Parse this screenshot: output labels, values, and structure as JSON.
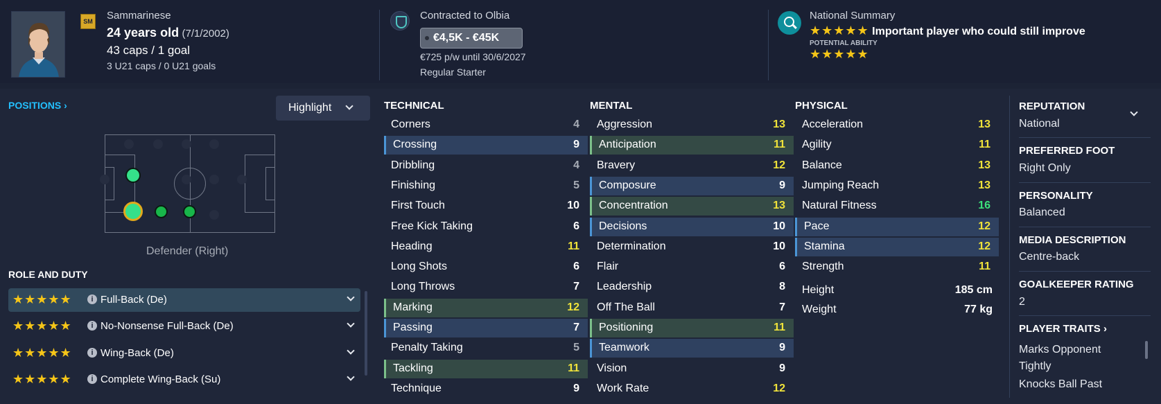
{
  "header": {
    "nationality": "Sammarinese",
    "age": "24 years old",
    "dob": "(7/1/2002)",
    "caps": "43 caps / 1 goal",
    "u21": "3 U21 caps / 0 U21 goals",
    "contract_title": "Contracted to Olbia",
    "value": "€4,5K - €45K",
    "wage": "€725 p/w until 30/6/2027",
    "squad_status": "Regular Starter",
    "summary_title": "National Summary",
    "summary_text": "Important player who could still improve",
    "potential_label": "POTENTIAL ABILITY",
    "current_stars": "★★★★★",
    "potential_stars": "★★★★★",
    "flag_icon": "flag-icon",
    "club_icon": "club-badge-icon",
    "search_icon": "search-icon"
  },
  "positions": {
    "heading": "POSITIONS ›",
    "highlight_label": "Highlight",
    "position_name": "Defender (Right)"
  },
  "roles": {
    "heading": "ROLE AND DUTY",
    "items": [
      {
        "stars": "★★★★★",
        "name": "Full-Back (De)"
      },
      {
        "stars": "★★★★★",
        "name": "No-Nonsense Full-Back (De)"
      },
      {
        "stars": "★★★★★",
        "name": "Wing-Back (De)"
      },
      {
        "stars": "★★★★★",
        "name": "Complete Wing-Back (Su)"
      }
    ]
  },
  "technical": {
    "heading": "TECHNICAL",
    "rows": [
      {
        "name": "Corners",
        "value": "4"
      },
      {
        "name": "Crossing",
        "value": "9"
      },
      {
        "name": "Dribbling",
        "value": "4"
      },
      {
        "name": "Finishing",
        "value": "5"
      },
      {
        "name": "First Touch",
        "value": "10"
      },
      {
        "name": "Free Kick Taking",
        "value": "6"
      },
      {
        "name": "Heading",
        "value": "11"
      },
      {
        "name": "Long Shots",
        "value": "6"
      },
      {
        "name": "Long Throws",
        "value": "7"
      },
      {
        "name": "Marking",
        "value": "12"
      },
      {
        "name": "Passing",
        "value": "7"
      },
      {
        "name": "Penalty Taking",
        "value": "5"
      },
      {
        "name": "Tackling",
        "value": "11"
      },
      {
        "name": "Technique",
        "value": "9"
      }
    ]
  },
  "mental": {
    "heading": "MENTAL",
    "rows": [
      {
        "name": "Aggression",
        "value": "13"
      },
      {
        "name": "Anticipation",
        "value": "11"
      },
      {
        "name": "Bravery",
        "value": "12"
      },
      {
        "name": "Composure",
        "value": "9"
      },
      {
        "name": "Concentration",
        "value": "13"
      },
      {
        "name": "Decisions",
        "value": "10"
      },
      {
        "name": "Determination",
        "value": "10"
      },
      {
        "name": "Flair",
        "value": "6"
      },
      {
        "name": "Leadership",
        "value": "8"
      },
      {
        "name": "Off The Ball",
        "value": "7"
      },
      {
        "name": "Positioning",
        "value": "11"
      },
      {
        "name": "Teamwork",
        "value": "9"
      },
      {
        "name": "Vision",
        "value": "9"
      },
      {
        "name": "Work Rate",
        "value": "12"
      }
    ]
  },
  "physical": {
    "heading": "PHYSICAL",
    "rows": [
      {
        "name": "Acceleration",
        "value": "13"
      },
      {
        "name": "Agility",
        "value": "11"
      },
      {
        "name": "Balance",
        "value": "13"
      },
      {
        "name": "Jumping Reach",
        "value": "13"
      },
      {
        "name": "Natural Fitness",
        "value": "16"
      },
      {
        "name": "Pace",
        "value": "12"
      },
      {
        "name": "Stamina",
        "value": "12"
      },
      {
        "name": "Strength",
        "value": "11"
      }
    ],
    "height_label": "Height",
    "height_value": "185 cm",
    "weight_label": "Weight",
    "weight_value": "77 kg"
  },
  "side": {
    "reputation_label": "REPUTATION",
    "reputation_value": "National",
    "foot_label": "PREFERRED FOOT",
    "foot_value": "Right Only",
    "personality_label": "PERSONALITY",
    "personality_value": "Balanced",
    "media_label": "MEDIA DESCRIPTION",
    "media_value": "Centre-back",
    "gk_label": "GOALKEEPER RATING",
    "gk_value": "2",
    "traits_label": "PLAYER TRAITS ›",
    "trait1_line1": "Marks Opponent",
    "trait1_line2": "Tightly",
    "trait2": "Knocks Ball Past"
  },
  "colors": {
    "low": "#a7acb6",
    "mid": "#ffffff",
    "good": "#f0e33a",
    "great": "#3ce07a",
    "accent": "#23c0ff",
    "star": "#f5c518"
  }
}
